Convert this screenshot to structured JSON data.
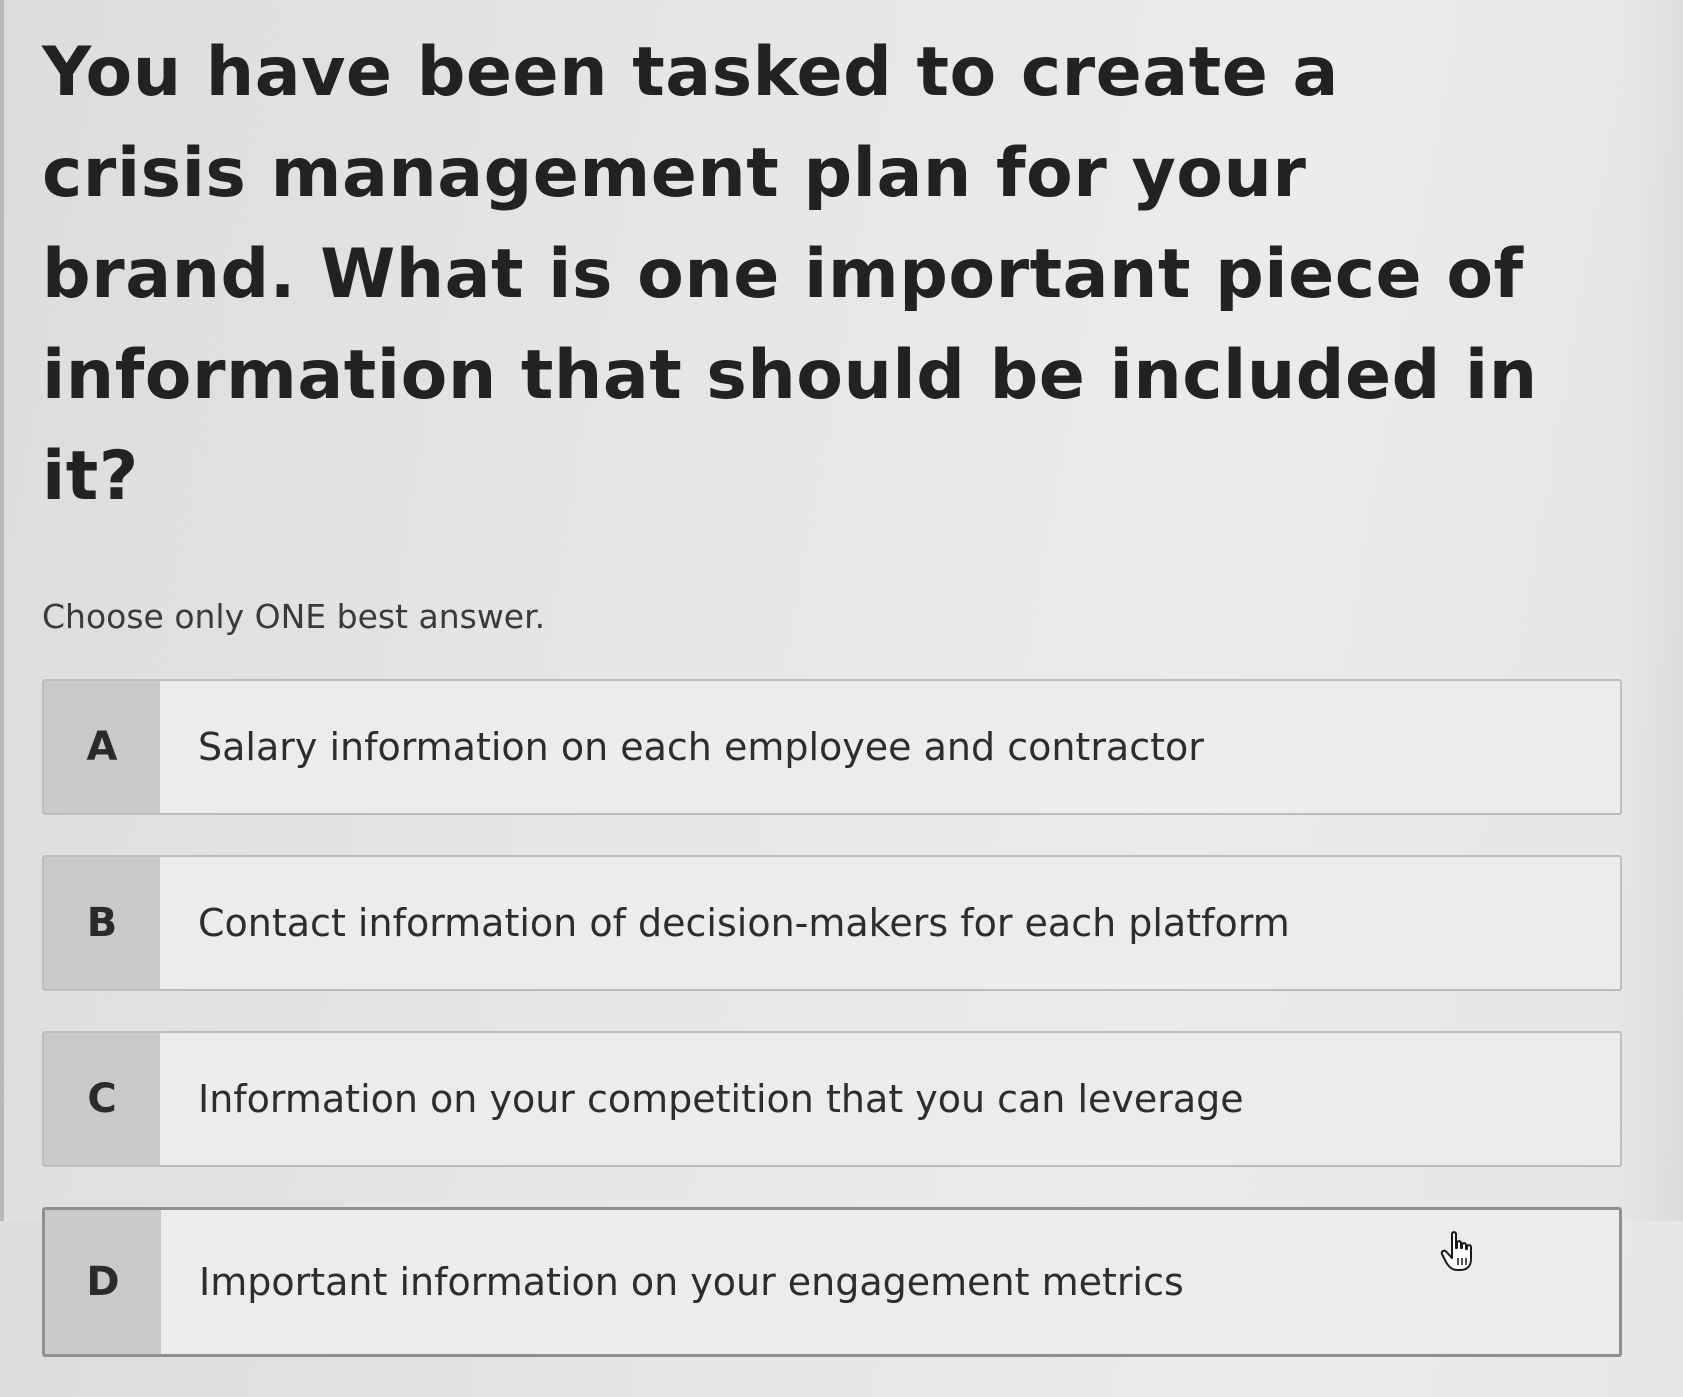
{
  "question": {
    "text": "You have been tasked to create a crisis management plan for your brand. What is one important piece of information that should be included in it?"
  },
  "instruction": "Choose only ONE best answer.",
  "options": [
    {
      "letter": "A",
      "text": "Salary information on each employee and contractor"
    },
    {
      "letter": "B",
      "text": "Contact information of decision-makers for each platform"
    },
    {
      "letter": "C",
      "text": "Information on your competition that you can leverage"
    },
    {
      "letter": "D",
      "text": "Important information on your engagement metrics"
    }
  ],
  "cursor": {
    "icon": "hand-pointer-icon",
    "hovered_option": "D"
  },
  "colors": {
    "background": "#e8e8e6",
    "letter_cell": "#c9c9c7",
    "option_border": "#bdbdbb",
    "text": "#222222"
  }
}
